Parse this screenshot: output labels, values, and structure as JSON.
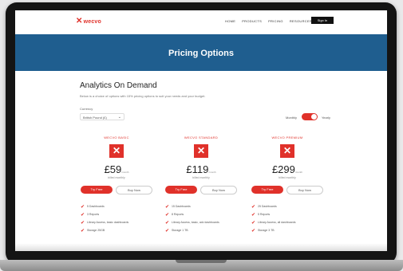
{
  "brand": {
    "name": "wecvo",
    "mark": "✕",
    "accent": "#e0312a",
    "banner_color": "#1f5e8f"
  },
  "nav": {
    "links": [
      "HOME",
      "PRODUCTS",
      "PRICING",
      "RESOURCES"
    ],
    "signin_label": "Sign In"
  },
  "banner": {
    "title": "Pricing Options"
  },
  "main": {
    "title": "Analytics On Demand",
    "subtitle": "Below is a choice of options with 15% pricing options to suit your needs and your budget.",
    "currency_label": "Currency",
    "currency_value": "British Pound (£)",
    "billing_monthly": "Monthly",
    "billing_yearly": "Yearly"
  },
  "plans": [
    {
      "name": "WECVO BASIC",
      "price": "£59",
      "per": "/month",
      "note": "billed monthly",
      "try_label": "Try Free",
      "buy_label": "Buy Now",
      "features": [
        "5 Dashboards",
        "3 Reports",
        "Library Access, basic dashboards",
        "Storage 25GB"
      ]
    },
    {
      "name": "WECVO STANDARD",
      "price": "£119",
      "per": "/month",
      "note": "billed monthly",
      "try_label": "Try Free",
      "buy_label": "Buy Now",
      "features": [
        "15 Dashboards",
        "8 Reports",
        "Library Access, basic, adv dashboards",
        "Storage 1 TB"
      ]
    },
    {
      "name": "WECVO PREMIUM",
      "price": "£299",
      "per": "/month",
      "note": "billed monthly",
      "try_label": "Try Free",
      "buy_label": "Buy Now",
      "features": [
        "25 Dashboards",
        "5 Reports",
        "Library Access, all dashboards",
        "Storage 3 TB"
      ]
    }
  ]
}
